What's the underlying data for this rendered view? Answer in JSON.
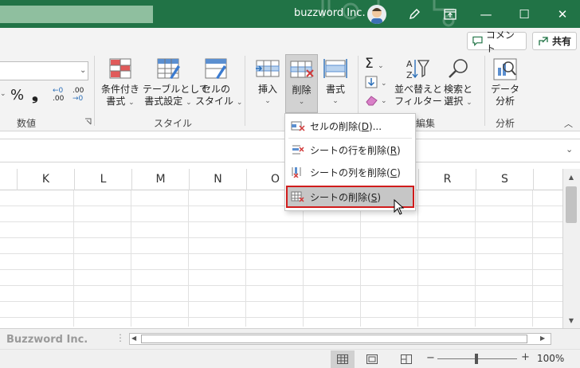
{
  "titlebar": {
    "company": "buzzword Inc.",
    "bg": "#217346",
    "icons": [
      "pen-icon",
      "restore-ribbon-icon",
      "minimize-icon",
      "maximize-icon",
      "close-icon"
    ],
    "min_glyph": "—",
    "max_glyph": "☐",
    "close_glyph": "✕"
  },
  "ribbon": {
    "comment_label": "コメント",
    "share_label": "共有",
    "number_group": {
      "label": "数値",
      "percent": "%",
      "comma": "❟",
      "inc_decimal_top": "←0",
      "inc_decimal_bottom": ".00",
      "dec_decimal_top": ".00",
      "dec_decimal_bottom": "→0"
    },
    "style_group": {
      "label": "スタイル",
      "cond_format": [
        "条件付き",
        "書式"
      ],
      "table_format": [
        "テーブルとして",
        "書式設定"
      ],
      "cell_style": [
        "セルの",
        "スタイル"
      ]
    },
    "cells_group": {
      "insert": "挿入",
      "delete": "削除",
      "format": "書式",
      "label_fragment": "編集"
    },
    "edit_group": {
      "sum": "Σ",
      "sort_filter": [
        "並べ替えと",
        "フィルター"
      ],
      "find_select": [
        "検索と",
        "選択"
      ]
    },
    "analysis_group": {
      "label": "分析",
      "data_analysis": [
        "データ",
        "分析"
      ]
    }
  },
  "dropdown": {
    "items": [
      {
        "label": "セルの削除(D)...",
        "pre": "セルの削除(",
        "key": "D",
        "post": ")..."
      },
      {
        "label": "シートの行を削除(R)",
        "pre": "シートの行を削除(",
        "key": "R",
        "post": ")"
      },
      {
        "label": "シートの列を削除(C)",
        "pre": "シートの列を削除(",
        "key": "C",
        "post": ")"
      },
      {
        "label": "シートの削除(S)",
        "pre": "シートの削除(",
        "key": "S",
        "post": ")"
      }
    ],
    "highlight_color": "#d01c1c"
  },
  "grid": {
    "columns": [
      "K",
      "L",
      "M",
      "N",
      "O",
      "",
      "",
      "R",
      "S"
    ]
  },
  "sheetbar": {
    "watermark": "Buzzword Inc."
  },
  "statusbar": {
    "zoom": "100%",
    "minus": "−",
    "plus": "+"
  }
}
